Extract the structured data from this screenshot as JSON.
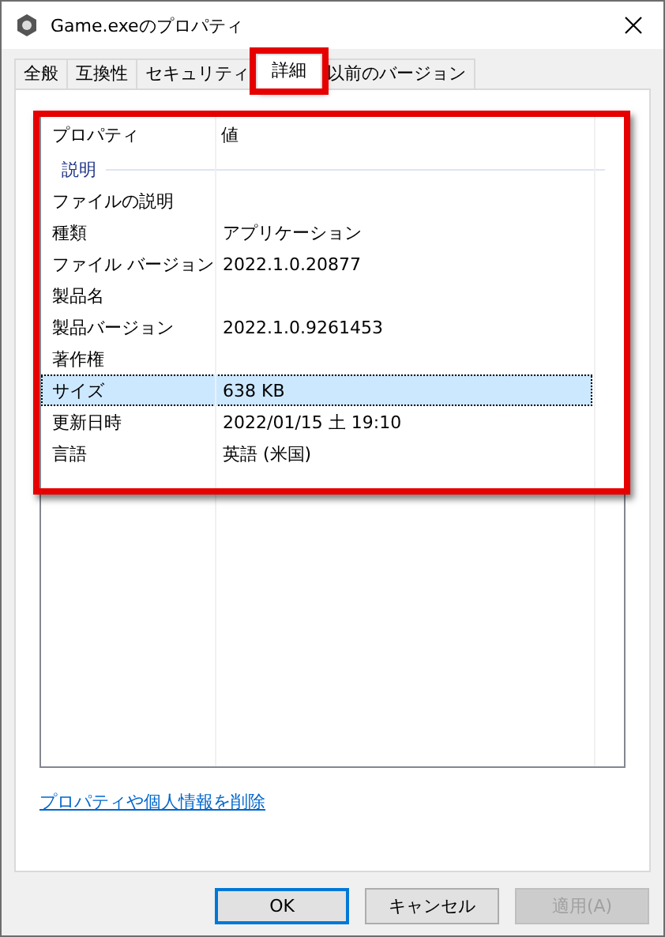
{
  "window": {
    "title": "Game.exeのプロパティ"
  },
  "tabs": [
    {
      "label": "全般",
      "selected": false,
      "highlighted": false
    },
    {
      "label": "互換性",
      "selected": false,
      "highlighted": false
    },
    {
      "label": "セキュリティ",
      "selected": false,
      "highlighted": false
    },
    {
      "label": "詳細",
      "selected": true,
      "highlighted": true
    },
    {
      "label": "以前のバージョン",
      "selected": false,
      "highlighted": false
    }
  ],
  "details": {
    "highlighted": true,
    "columns": [
      "プロパティ",
      "値"
    ],
    "sections": [
      {
        "heading": "説明",
        "rows": [
          {
            "property": "ファイルの説明",
            "selected": false
          },
          {
            "property": "種類",
            "value": "アプリケーション",
            "selected": false
          },
          {
            "property": "ファイル バージョン",
            "value": "2022.1.0.20877",
            "selected": false
          },
          {
            "property": "製品名",
            "selected": false
          },
          {
            "property": "製品バージョン",
            "value": "2022.1.0.9261453",
            "selected": false
          },
          {
            "property": "著作権",
            "selected": false
          },
          {
            "property": "サイズ",
            "value": "638 KB",
            "selected": true
          },
          {
            "property": "更新日時",
            "value": "2022/01/15 土 19:10",
            "selected": false
          },
          {
            "property": "言語",
            "value": "英語 (米国)",
            "selected": false
          }
        ]
      }
    ]
  },
  "link": "プロパティや個人情報を削除",
  "buttons": [
    {
      "label": "OK",
      "kind": "default",
      "disabled": false
    },
    {
      "label": "キャンセル",
      "kind": "normal",
      "disabled": false
    },
    {
      "label": "適用(A)",
      "kind": "normal",
      "disabled": true
    }
  ]
}
